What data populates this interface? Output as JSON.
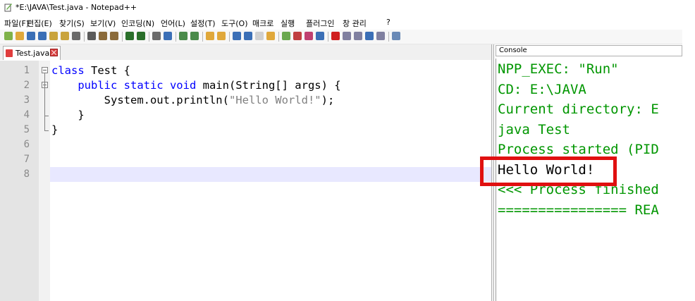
{
  "window": {
    "title": "*E:\\JAVA\\Test.java - Notepad++"
  },
  "menu": [
    "파일(F)",
    "편집(E)",
    "찾기(S)",
    "보기(V)",
    "인코딩(N)",
    "언어(L)",
    "설정(T)",
    "도구(O)",
    "매크로",
    "실행",
    "플러그인",
    "창 관리",
    "?"
  ],
  "toolbar_icons": [
    "new-file-icon",
    "open-file-icon",
    "save-icon",
    "save-all-icon",
    "close-icon",
    "close-all-icon",
    "print-icon",
    "cut-icon",
    "copy-icon",
    "paste-icon",
    "undo-icon",
    "redo-icon",
    "find-icon",
    "replace-icon",
    "zoom-in-icon",
    "zoom-out-icon",
    "sync-v-icon",
    "sync-h-icon",
    "word-wrap-icon",
    "show-all-chars-icon",
    "indent-guide-icon",
    "folder-as-workspace-icon",
    "document-map-icon",
    "function-list-icon",
    "udl-icon",
    "monitor-icon",
    "record-macro-icon",
    "stop-macro-icon",
    "play-macro-icon",
    "run-macro-multiple-icon",
    "save-macro-icon",
    "console-icon"
  ],
  "tab": {
    "label": "Test.java"
  },
  "editor": {
    "line_numbers": [
      "1",
      "2",
      "3",
      "4",
      "5",
      "6",
      "7",
      "8"
    ],
    "lines": [
      [
        {
          "t": "class",
          "c": "kw"
        },
        {
          "t": " Test {",
          "c": "plain"
        }
      ],
      [
        {
          "t": "    ",
          "c": "plain"
        },
        {
          "t": "public static void",
          "c": "kw"
        },
        {
          "t": " main(String[] args) {",
          "c": "plain"
        }
      ],
      [
        {
          "t": "        System.out.println(",
          "c": "plain"
        },
        {
          "t": "\"Hello World!\"",
          "c": "str"
        },
        {
          "t": ");",
          "c": "plain"
        }
      ],
      [
        {
          "t": "    }",
          "c": "plain"
        }
      ],
      [
        {
          "t": "}",
          "c": "plain"
        }
      ],
      [],
      [],
      []
    ]
  },
  "console": {
    "title": "Console",
    "lines": [
      "NPP_EXEC: \"Run\"",
      "CD: E:\\JAVA",
      "Current directory: E",
      "java Test",
      "Process started (PID",
      "Hello World!",
      "<<< Process finished",
      "================ REA"
    ],
    "highlighted_line": "Hello World!"
  },
  "colors": {
    "keyword": "#0000ff",
    "string": "#808080",
    "console_text": "#009600",
    "highlight": "#e01010"
  }
}
